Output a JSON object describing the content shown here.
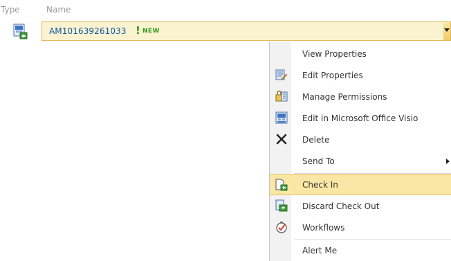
{
  "header": {
    "type_label": "Type",
    "name_label": "Name"
  },
  "item": {
    "name": "AM101639261033",
    "new_badge": "NEW",
    "type_icon": "visio-document-checked-out-icon"
  },
  "menu": {
    "items": [
      {
        "label": "View Properties",
        "icon": "none"
      },
      {
        "label": "Edit Properties",
        "icon": "edit-properties-icon"
      },
      {
        "label": "Manage Permissions",
        "icon": "manage-permissions-icon"
      },
      {
        "label": "Edit in Microsoft Office Visio",
        "icon": "visio-edit-icon"
      },
      {
        "label": "Delete",
        "icon": "delete-x-icon"
      },
      {
        "label": "Send To",
        "icon": "none",
        "has_submenu": true
      },
      {
        "label": "Check In",
        "icon": "check-in-icon",
        "highlighted": true
      },
      {
        "label": "Discard Check Out",
        "icon": "discard-check-out-icon"
      },
      {
        "label": "Workflows",
        "icon": "workflows-icon"
      },
      {
        "label": "Alert Me",
        "icon": "none"
      }
    ]
  },
  "colors": {
    "link": "#0f55a3",
    "new_badge": "#2f9a1c",
    "highlight": "#fbe7a5",
    "header_text": "#9a9a9a"
  }
}
